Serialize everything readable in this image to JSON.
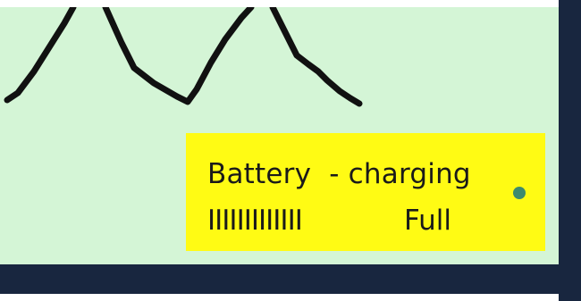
{
  "battery": {
    "title": "Battery  - charging",
    "level_bars": "IIIIIIIIIIIII",
    "status": "Full",
    "indicator_color": "#3d8a6e"
  },
  "colors": {
    "screen_background": "#d4f5d6",
    "panel_background": "#fffb14",
    "bezel": "#18263f"
  }
}
